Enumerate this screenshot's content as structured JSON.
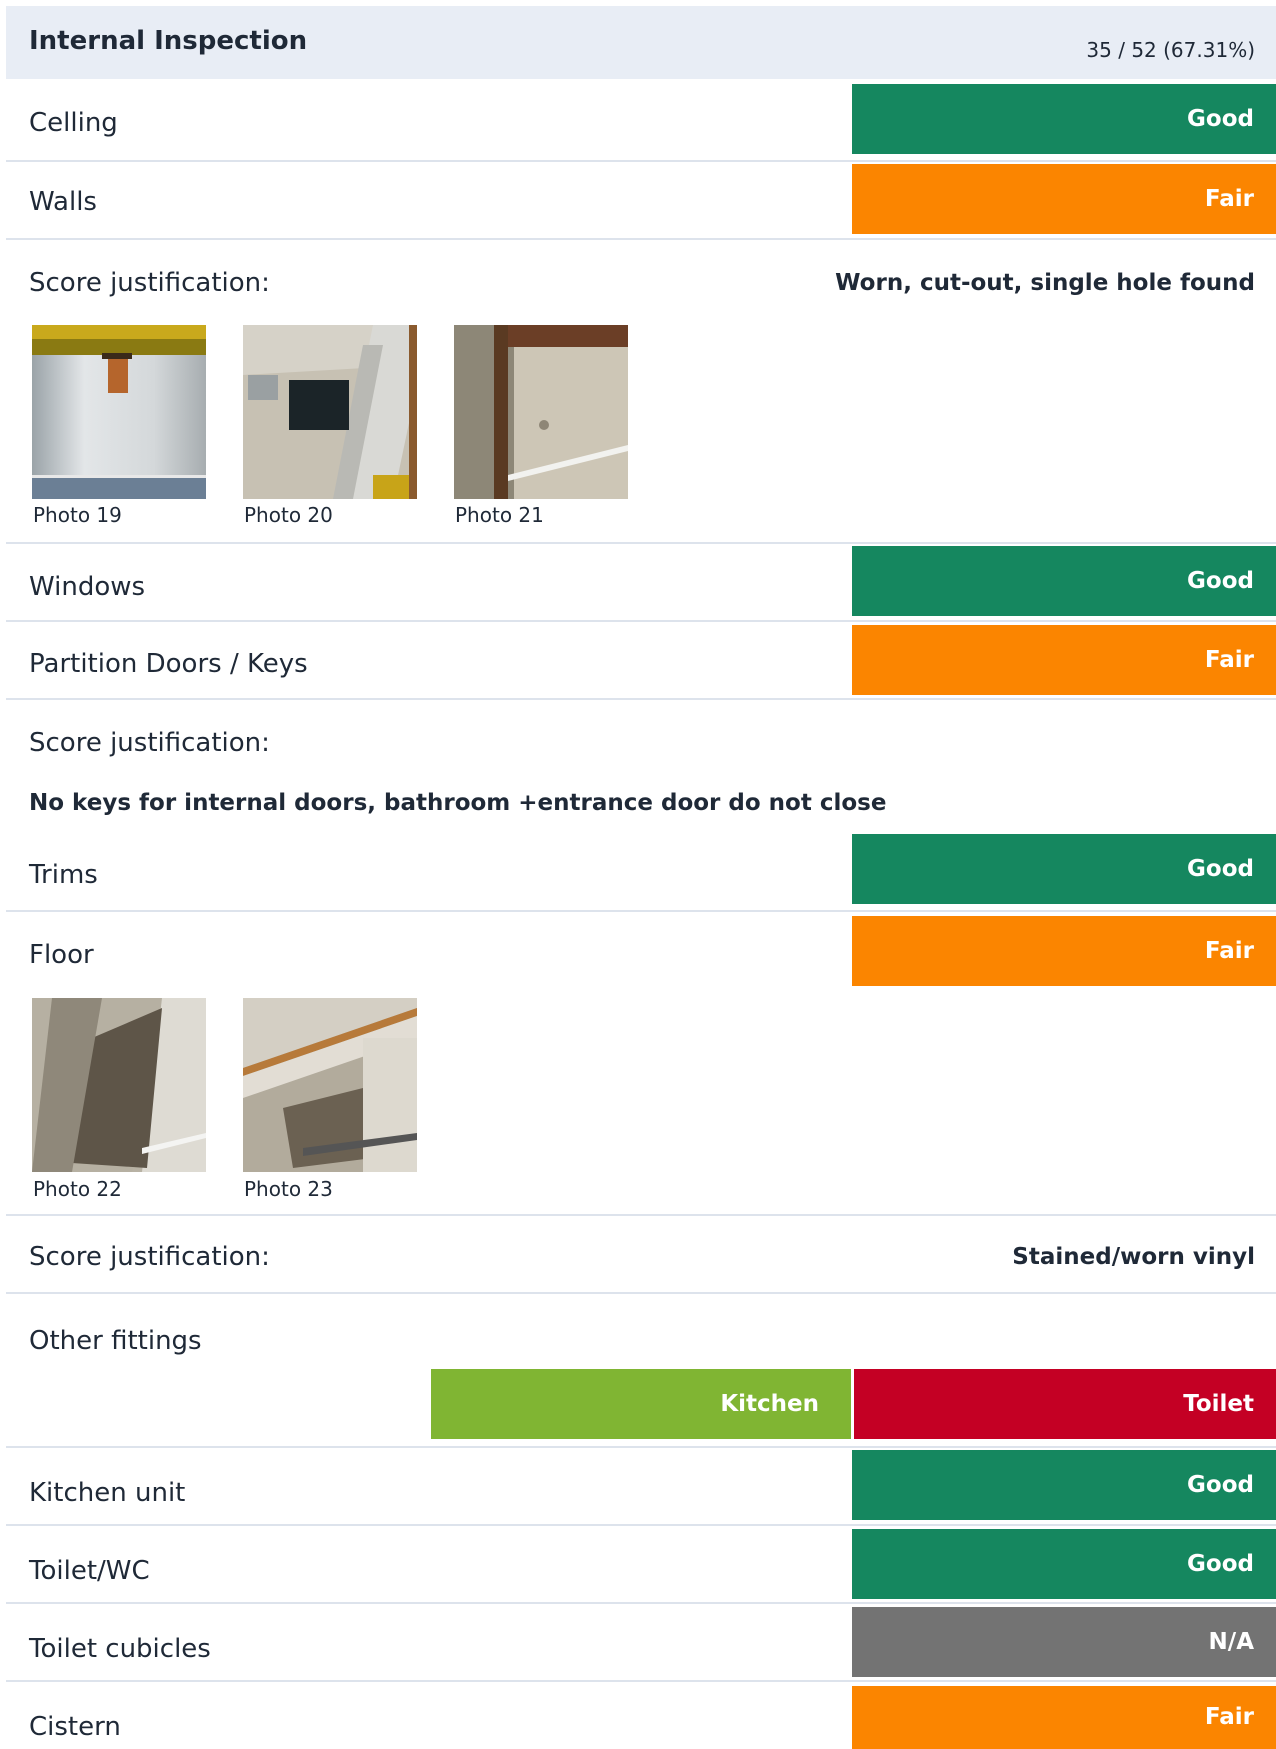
{
  "colors": {
    "good": "#15875f",
    "fair": "#fb8500",
    "na": "#737373",
    "kitchen": "#80b533",
    "toilet": "#c40024",
    "header_bg": "#e8edf5"
  },
  "header": {
    "title": "Internal Inspection",
    "score": "35 / 52 (67.31%)"
  },
  "justification_label": "Score justification:",
  "items": {
    "celling": {
      "label": "Celling",
      "rating": "Good"
    },
    "walls": {
      "label": "Walls",
      "rating": "Fair",
      "justification": "Worn, cut-out, single hole found",
      "photos": [
        "Photo 19",
        "Photo 20",
        "Photo 21"
      ]
    },
    "windows": {
      "label": "Windows",
      "rating": "Good"
    },
    "partition": {
      "label": "Partition Doors / Keys",
      "rating": "Fair",
      "justification": "No keys for internal doors, bathroom +entrance door do not close"
    },
    "trims": {
      "label": "Trims",
      "rating": "Good"
    },
    "floor": {
      "label": "Floor",
      "rating": "Fair",
      "photos": [
        "Photo 22",
        "Photo 23"
      ],
      "justification": "Stained/worn vinyl"
    },
    "other": {
      "label": "Other fittings",
      "categories": [
        "Kitchen",
        "Toilet"
      ]
    },
    "kitchen_unit": {
      "label": "Kitchen unit",
      "rating": "Good"
    },
    "toilet_wc": {
      "label": "Toilet/WC",
      "rating": "Good"
    },
    "toilet_cubicles": {
      "label": "Toilet cubicles",
      "rating": "N/A"
    },
    "cistern": {
      "label": "Cistern",
      "rating": "Fair"
    }
  }
}
